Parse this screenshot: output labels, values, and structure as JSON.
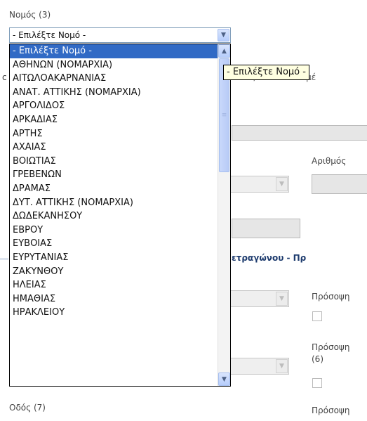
{
  "nomos_label": "Νομός (3)",
  "nomos_select": {
    "selected_value": "- Επιλέξτε Νομό -",
    "tooltip": "- Επιλέξτε Νομό -",
    "options": [
      "- Επιλέξτε Νομό -",
      "ΑΘΗΝΩΝ (ΝΟΜΑΡΧΙΑ)",
      "ΑΙΤΩΛΟΑΚΑΡΝΑΝΙΑΣ",
      "ΑΝΑΤ. ΑΤΤΙΚΗΣ (ΝΟΜΑΡΧΙΑ)",
      "ΑΡΓΟΛΙΔΟΣ",
      "ΑΡΚΑΔΙΑΣ",
      "ΑΡΤΗΣ",
      "ΑΧΑΙΑΣ",
      "ΒΟΙΩΤΙΑΣ",
      "ΓΡΕΒΕΝΩΝ",
      "ΔΡΑΜΑΣ",
      "ΔΥΤ. ΑΤΤΙΚΗΣ (ΝΟΜΑΡΧΙΑ)",
      "ΔΩΔΕΚΑΝΗΣΟΥ",
      "ΕΒΡΟΥ",
      "ΕΥΒΟΙΑΣ",
      "ΕΥΡΥΤΑΝΙΑΣ",
      "ΖΑΚΥΝΘΟΥ",
      "ΗΛΕΙΑΣ",
      "ΗΜΑΘΙΑΣ",
      "ΗΡΑΚΛΕΙΟΥ"
    ]
  },
  "background": {
    "partial_text_right": "ικό/κοιν.ικό διαμέ",
    "partial_text_left_c": "c",
    "arithmos_label": "Αριθμός",
    "heading_partial": "ετραγώνου - Πρ",
    "prosopsi_1": "Πρόσοψη",
    "prosopsi_2": "Πρόσοψη",
    "prosopsi_2_num": "(6)",
    "prosopsi_3": "Πρόσοψη",
    "odos_label": "Οδός (7)"
  },
  "colors": {
    "selection": "#316ac5",
    "tooltip_bg": "#ffffe1",
    "heading": "#1d3b6e"
  }
}
